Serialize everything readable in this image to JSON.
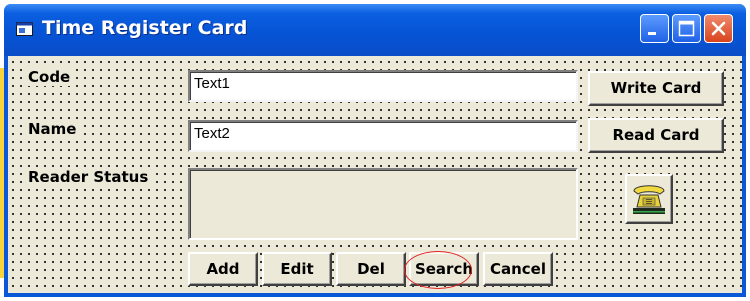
{
  "window": {
    "title": "Time Register Card",
    "icon": "app-window-icon",
    "controls": [
      "minimize-icon",
      "maximize-icon",
      "close-icon"
    ]
  },
  "form": {
    "code_label": "Code",
    "code_value": "Text1",
    "name_label": "Name",
    "name_value": "Text2",
    "reader_status_label": "Reader Status",
    "reader_status_value": ""
  },
  "side_buttons": {
    "write_card": "Write Card",
    "read_card": "Read Card",
    "phone_icon": "telephone-icon"
  },
  "bottom_buttons": {
    "add": "Add",
    "edit": "Edit",
    "del": "Del",
    "search": "Search",
    "cancel": "Cancel"
  },
  "colors": {
    "titlebar": "#0654d6",
    "client_background": "#ece9d8",
    "highlight": "#e02020",
    "side_strip": "#f9d33b"
  }
}
